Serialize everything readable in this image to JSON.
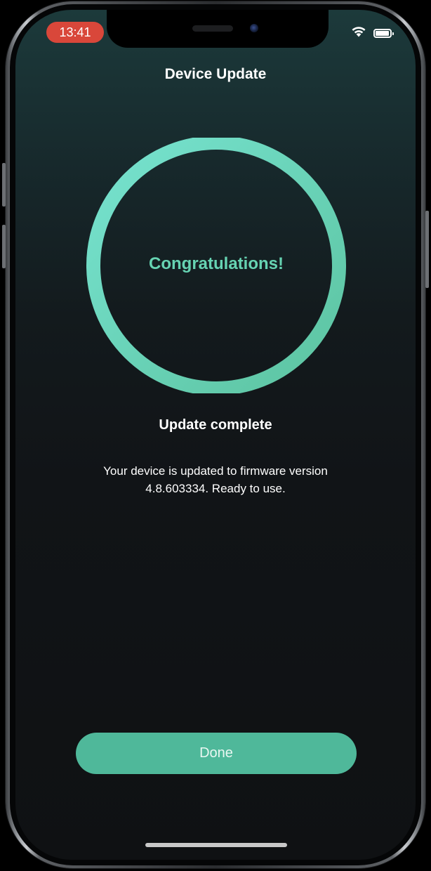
{
  "status_bar": {
    "time": "13:41",
    "time_pill_color": "#d9473a",
    "wifi_icon": "wifi-icon",
    "battery_icon": "battery-icon"
  },
  "nav": {
    "title": "Device Update"
  },
  "progress_ring": {
    "label": "Congratulations!",
    "progress": 1.0,
    "gradient_start": "#5cc3a0",
    "gradient_end": "#77e3d0"
  },
  "content": {
    "headline": "Update complete",
    "message_line1": "Your device is updated to firmware version",
    "message_line2": "4.8.603334. Ready to use."
  },
  "actions": {
    "done_label": "Done",
    "done_color": "#4fb89a"
  }
}
